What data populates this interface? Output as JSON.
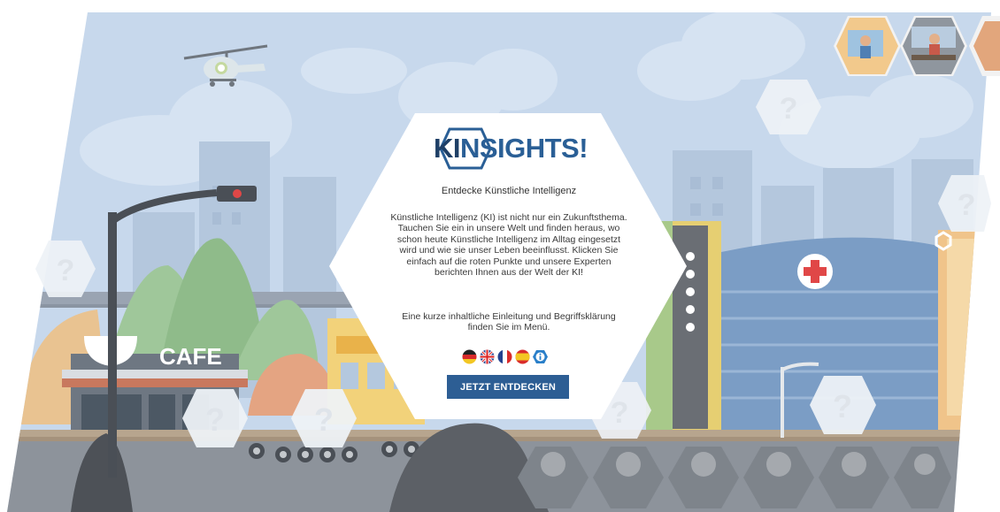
{
  "intro": {
    "logo_ki": "KI",
    "logo_rest": "NSIGHTS!",
    "tagline": "Entdecke Künstliche Intelligenz",
    "body": "Künstliche Intelligenz (KI) ist nicht nur ein Zukunftsthema. Tauchen Sie ein in unsere Welt und finden heraus, wo schon heute Künstliche Intelligenz im Alltag eingesetzt wird und wie sie unser Leben beeinflusst. Klicken Sie einfach auf die roten Punkte und unsere Experten berichten Ihnen aus der Welt der KI!",
    "menu_hint": "Eine kurze inhaltliche Einleitung und Begriffsklärung finden Sie im Menü.",
    "start_label": "JETZT ENTDECKEN",
    "languages": [
      "german-flag-icon",
      "uk-flag-icon",
      "france-flag-icon",
      "spain-flag-icon",
      "info-icon"
    ]
  },
  "scene": {
    "cafe_sign": "CAFE",
    "hotspot_glyph": "?"
  },
  "colors": {
    "brand_dark": "#1e3f66",
    "brand": "#2d5e94",
    "sky": "#c4d6ea",
    "road": "#8f959e"
  }
}
